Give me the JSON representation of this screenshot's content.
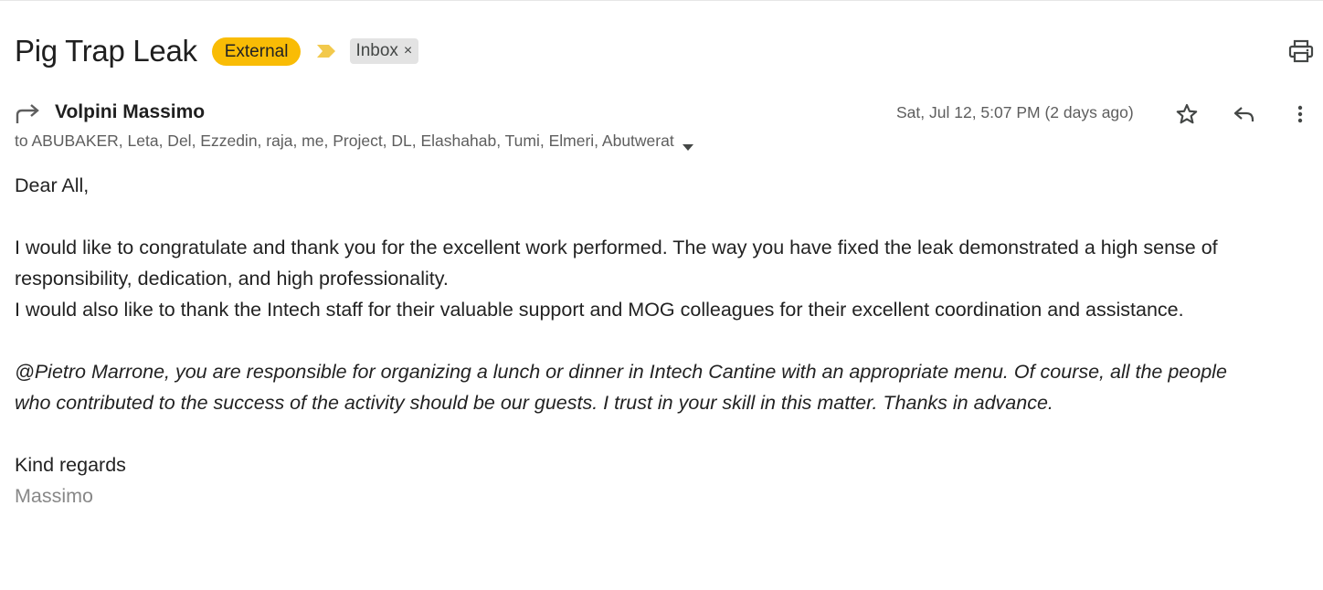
{
  "header": {
    "subject": "Pig Trap Leak",
    "external_badge": "External",
    "label": "Inbox",
    "label_remove": "×",
    "colors": {
      "external_badge": "#f9bc05",
      "importance_marker": "#f2c94c"
    }
  },
  "icons": {
    "print": "print-icon",
    "forward_indicator": "forward-icon",
    "star": "star-icon",
    "reply": "reply-icon",
    "more": "more-vert-icon",
    "recipients_toggle": "caret-down-icon",
    "importance": "importance-marker-icon"
  },
  "message": {
    "sender": "Volpini Massimo",
    "recipients": "to ABUBAKER, Leta, Del, Ezzedin, raja, me, Project, DL, Elashahab, Tumi, Elmeri, Abutwerat",
    "date": "Sat, Jul 12, 5:07 PM (2 days ago)"
  },
  "body": {
    "greeting": "Dear All,",
    "para1_line1": "I would like to congratulate and thank you for the excellent work performed. The way you have fixed the leak demonstrated a high sense of",
    "para1_line2": "responsibility, dedication, and high professionality.",
    "para1_line3": "I would also like to thank the Intech staff for their valuable support and MOG colleagues for their excellent coordination and assistance.",
    "para2_line1": "@Pietro Marrone, you are responsible for organizing a lunch or dinner in Intech Cantine with an appropriate menu. Of course, all the people",
    "para2_line2": "who contributed to the success of the activity should be our guests. I trust in your skill in this matter. Thanks in advance.",
    "closing": "Kind regards",
    "signature": "Massimo"
  }
}
